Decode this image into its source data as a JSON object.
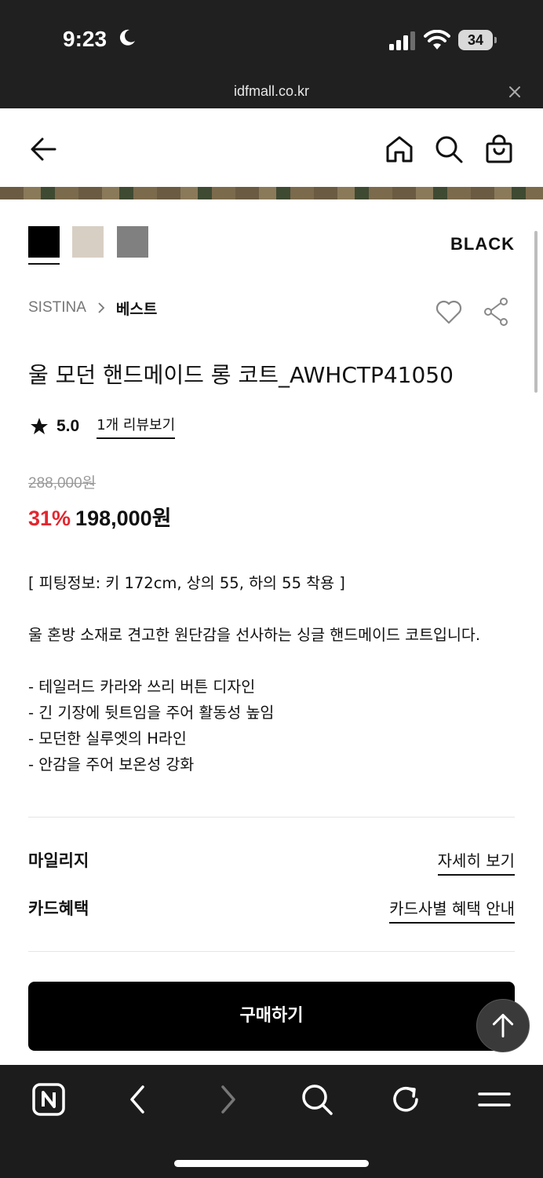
{
  "status_bar": {
    "time": "9:23",
    "battery": "34"
  },
  "url_bar": {
    "domain": "idfmall.co.kr"
  },
  "swatches": {
    "colors": [
      "#000000",
      "#d8cfc4",
      "#808080"
    ],
    "selected_index": 0,
    "selected_name": "BLACK"
  },
  "breadcrumb": {
    "brand": "SISTINA",
    "category": "베스트"
  },
  "product": {
    "title": "울 모던 핸드메이드 롱 코트_AWHCTP41050",
    "rating": "5.0",
    "review_link": "1개 리뷰보기",
    "original_price": "288,000원",
    "discount": "31%",
    "sale_price": "198,000원"
  },
  "description": {
    "fitting": "[ 피팅정보: 키 172cm, 상의 55, 하의 55 착용 ]",
    "summary": "울 혼방 소재로 견고한 원단감을 선사하는 싱글 핸드메이드 코트입니다.",
    "bullets": [
      "- 테일러드 카라와 쓰리 버튼 디자인",
      "- 긴 기장에 뒷트임을 주어 활동성 높임",
      "- 모던한 실루엣의 H라인",
      "- 안감을 주어 보온성 강화"
    ]
  },
  "info": {
    "mileage_label": "마일리지",
    "mileage_link": "자세히 보기",
    "card_label": "카드혜택",
    "card_link": "카드사별 혜택 안내"
  },
  "buy_button": "구매하기",
  "colors": {
    "discount_red": "#e3262e",
    "primary": "#000000"
  },
  "icons": {
    "header": [
      "back-arrow-icon",
      "home-icon",
      "search-icon",
      "shopping-bag-icon"
    ],
    "browser": [
      "naver-n-icon",
      "back-icon",
      "forward-icon",
      "search-icon",
      "reload-icon",
      "menu-icon"
    ]
  }
}
